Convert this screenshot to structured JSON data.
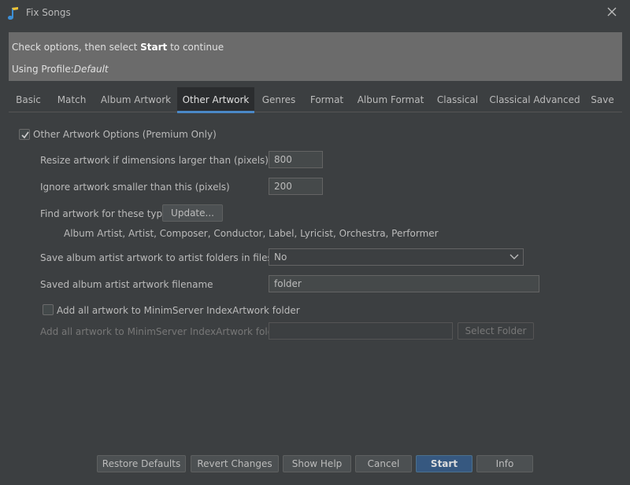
{
  "window": {
    "title": "Fix Songs"
  },
  "banner": {
    "line1_prefix": "Check options, then select ",
    "line1_bold": "Start",
    "line1_suffix": " to continue",
    "line2_prefix": "Using Profile:",
    "line2_profile": "Default"
  },
  "tabs": [
    {
      "label": "Basic"
    },
    {
      "label": "Match"
    },
    {
      "label": "Album Artwork"
    },
    {
      "label": "Other Artwork"
    },
    {
      "label": "Genres"
    },
    {
      "label": "Format"
    },
    {
      "label": "Album Format"
    },
    {
      "label": "Classical"
    },
    {
      "label": "Classical Advanced"
    },
    {
      "label": "Save"
    }
  ],
  "options": {
    "main_checkbox_label": "Other Artwork Options (Premium Only)",
    "resize_label": "Resize artwork if dimensions larger than (pixels)",
    "resize_value": "800",
    "ignore_label": "Ignore artwork smaller than this (pixels)",
    "ignore_value": "200",
    "find_types_label": "Find artwork for these types:",
    "update_button": "Update...",
    "types_list": "Album Artist, Artist, Composer, Conductor, Label, Lyricist, Orchestra, Performer",
    "save_folders_label": "Save album artist artwork to artist folders in filesystem",
    "save_folders_value": "No",
    "filename_label": "Saved album artist artwork filename",
    "filename_value": "folder",
    "minim_checkbox_label": "Add all artwork to MinimServer IndexArtwork folder",
    "minim_folder_label": "Add all artwork to MinimServer IndexArtwork folder",
    "minim_folder_value": "",
    "select_folder_button": "Select Folder"
  },
  "footer": {
    "restore_defaults": "Restore Defaults",
    "revert_changes": "Revert Changes",
    "show_help": "Show Help",
    "cancel": "Cancel",
    "start": "Start",
    "info": "Info"
  },
  "colors": {
    "background": "#3c3f41",
    "banner": "#6b6b6b",
    "accent": "#4a88c7",
    "primary_button": "#365880"
  },
  "states": {
    "main_checkbox_checked": true,
    "minim_checkbox_checked": false,
    "active_tab": "Other Artwork"
  }
}
